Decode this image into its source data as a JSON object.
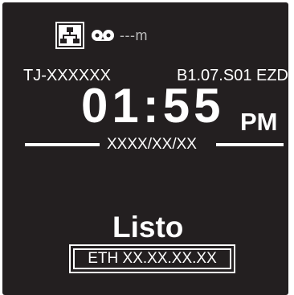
{
  "status": {
    "network_icon": "network-icon",
    "tape_icon": "tape-icon",
    "remaining_length": "---m"
  },
  "info": {
    "model": "TJ-XXXXXX",
    "firmware": "B1.07.S01 EZD"
  },
  "clock": {
    "time": "01:55",
    "period": "PM",
    "date": "XXXX/XX/XX"
  },
  "state": {
    "label": "Listo",
    "ip_address": "ETH XX.XX.XX.XX"
  },
  "colors": {
    "screen_background": "#231f20",
    "foreground": "#ffffff",
    "dim_text": "#b9b9b9"
  }
}
